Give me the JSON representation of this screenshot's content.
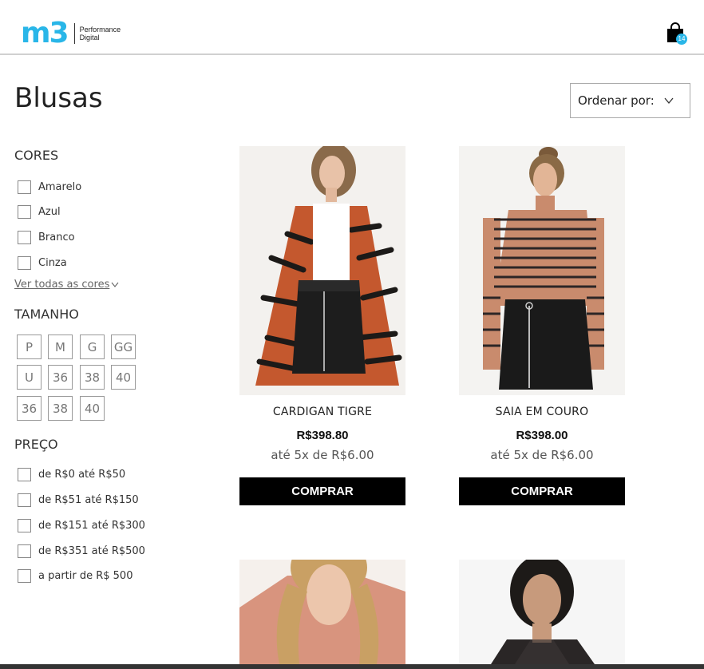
{
  "header": {
    "logo_mark": "m3",
    "logo_line1": "Performance",
    "logo_line2": "Digital",
    "cart_count": "14"
  },
  "page": {
    "title": "Blusas",
    "sort_label": "Ordenar por:"
  },
  "filters": {
    "colors": {
      "title": "CORES",
      "options": [
        "Amarelo",
        "Azul",
        "Branco",
        "Cinza"
      ],
      "see_all": "Ver todas as cores"
    },
    "sizes": {
      "title": "TAMANHO",
      "options": [
        "P",
        "M",
        "G",
        "GG",
        "U",
        "36",
        "38",
        "40",
        "36",
        "38",
        "40"
      ]
    },
    "price": {
      "title": "PREÇO",
      "options": [
        "de R$0 até R$50",
        "de R$51 até R$150",
        "de R$151 até R$300",
        "de R$351 até R$500",
        "a partir de R$ 500"
      ]
    }
  },
  "products": [
    {
      "name": "CARDIGAN TIGRE",
      "price": "R$398.80",
      "installments": "até 5x de R$6.00",
      "button": "COMPRAR"
    },
    {
      "name": "SAIA EM COURO",
      "price": "R$398.00",
      "installments": "até 5x de R$6.00",
      "button": "COMPRAR"
    }
  ],
  "colors": {
    "accent": "#29b6e8",
    "button_bg": "#000000",
    "button_text": "#ffffff"
  }
}
